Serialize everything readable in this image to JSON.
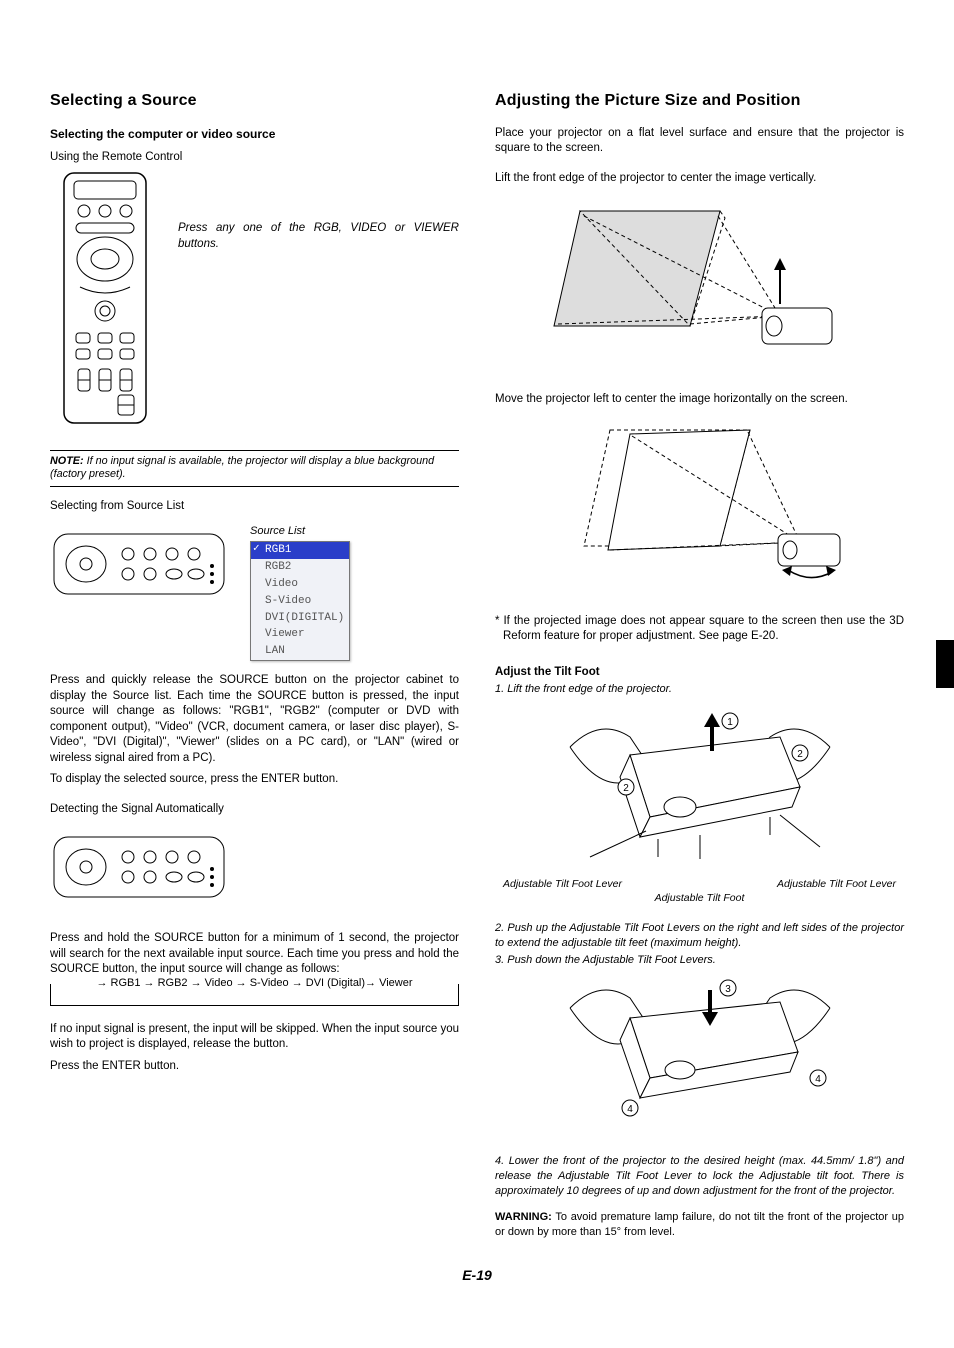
{
  "left": {
    "h_select_source": "Selecting a Source",
    "h_select_computer": "Selecting the computer or video source",
    "using_remote": "Using the Remote Control",
    "remote_caption": "Press any one of the RGB, VIDEO or VIEWER buttons.",
    "note_label": "NOTE:",
    "note_text": " If no input signal is available, the projector will display a blue background (factory preset).",
    "selecting_from_list": "Selecting from Source List",
    "source_list_title": "Source List",
    "source_items": [
      "RGB1",
      "RGB2",
      "Video",
      "S-Video",
      "DVI(DIGITAL)",
      "Viewer",
      "LAN"
    ],
    "press_release": "Press and quickly release the SOURCE button on the projector cabinet to display the Source list. Each time the SOURCE button is pressed, the input source will change as follows: \"RGB1\", \"RGB2\" (computer or DVD with component output), \"Video\" (VCR, document camera, or laser disc player), S-Video\", \"DVI (Digital)\", \"Viewer\" (slides on a PC card), or \"LAN\" (wired or wireless signal aired from a PC).",
    "to_display": "To display the selected source, press the ENTER button.",
    "detecting": "Detecting the Signal Automatically",
    "press_hold": "Press and hold the SOURCE button for a minimum of 1 second, the projector will search for the next available input source. Each time you press and hold the SOURCE button, the input source will change as follows:",
    "flow": "→ RGB1 → RGB2 → Video → S-Video → DVI (Digital)→ Viewer",
    "if_no_input": "If no input signal is present, the input will be skipped. When the input source you wish to project is displayed, release the button.",
    "press_enter": "Press the ENTER button."
  },
  "right": {
    "h_adjust": "Adjusting the Picture Size and Position",
    "place": "Place your projector on a flat level surface and ensure that the projector is square to the screen.",
    "lift_front": "Lift the front edge of the projector to center the image vertically.",
    "move_left": "Move the projector left to center the image horizontally on the screen.",
    "if_not_square": "*  If the projected image does not appear square to the screen then use the 3D Reform feature for proper adjustment. See page E-20.",
    "adjust_tilt_h": "Adjust the Tilt Foot",
    "step1": "1. Lift the front edge of the projector.",
    "label_lever_r": "Adjustable Tilt Foot Lever",
    "label_lever_l": "Adjustable Tilt Foot Lever",
    "label_foot": "Adjustable Tilt Foot",
    "step2": "2. Push up the Adjustable Tilt Foot Levers on the right and left sides of the projector to extend the adjustable tilt feet (maximum height).",
    "step3": "3. Push down the Adjustable Tilt Foot Levers.",
    "step4": "4. Lower the front of the projector to the desired height (max. 44.5mm/ 1.8\") and release the Adjustable Tilt Foot Lever to lock the Adjustable tilt foot. There is approximately 10 degrees of up and down adjustment for the front of the projector.",
    "warn_label": "WARNING:",
    "warn_text": " To avoid premature lamp failure, do not tilt the front of the projector up or down by more than 15° from level."
  },
  "page_num": "E-19"
}
